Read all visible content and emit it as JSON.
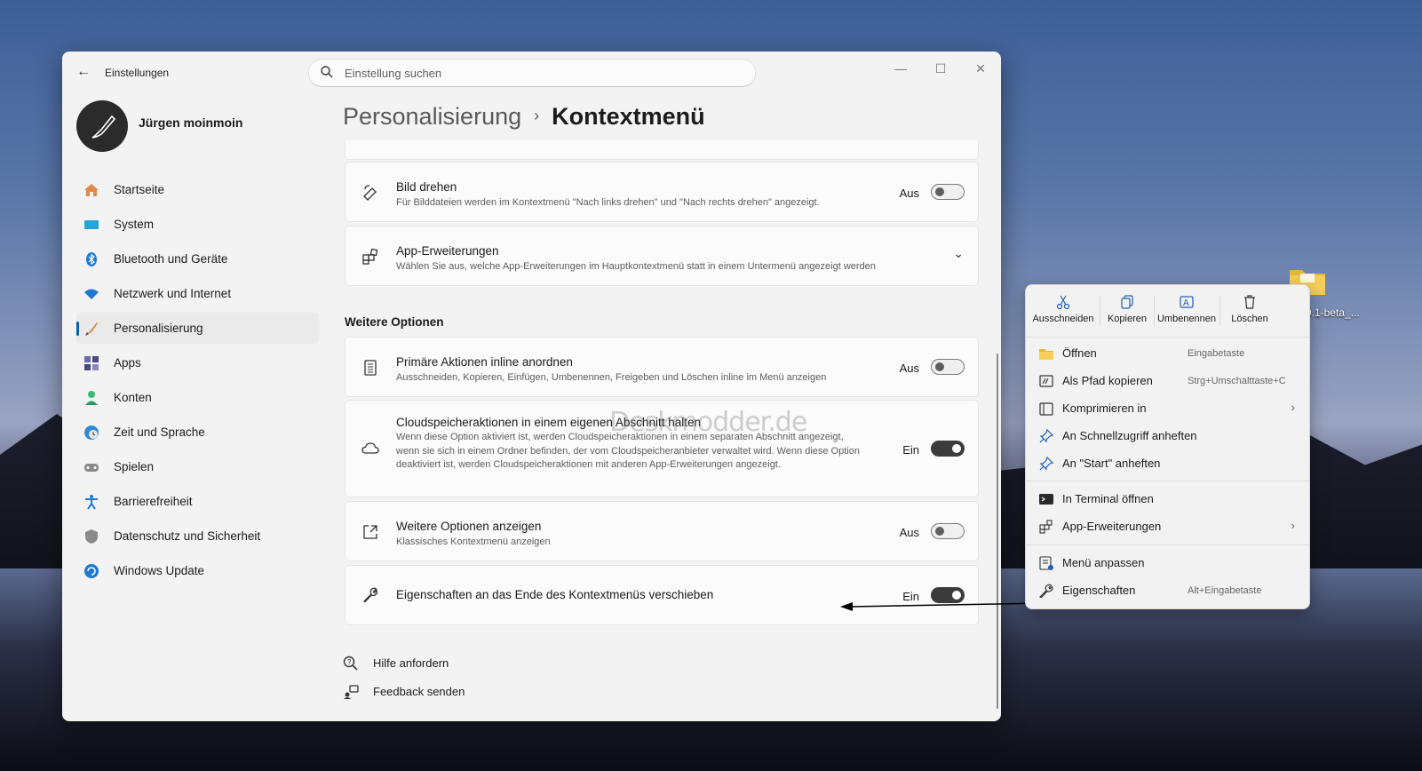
{
  "window": {
    "title": "Einstellungen",
    "search_placeholder": "Einstellung suchen",
    "user_name": "Jürgen moinmoin"
  },
  "nav": [
    {
      "label": "Startseite",
      "icon": "home-icon"
    },
    {
      "label": "System",
      "icon": "system-icon"
    },
    {
      "label": "Bluetooth und Geräte",
      "icon": "bluetooth-icon"
    },
    {
      "label": "Netzwerk und Internet",
      "icon": "wifi-icon"
    },
    {
      "label": "Personalisierung",
      "icon": "brush-icon",
      "active": true
    },
    {
      "label": "Apps",
      "icon": "apps-icon"
    },
    {
      "label": "Konten",
      "icon": "account-icon"
    },
    {
      "label": "Zeit und Sprache",
      "icon": "clock-globe-icon"
    },
    {
      "label": "Spielen",
      "icon": "gamepad-icon"
    },
    {
      "label": "Barrierefreiheit",
      "icon": "accessibility-icon"
    },
    {
      "label": "Datenschutz und Sicherheit",
      "icon": "shield-icon"
    },
    {
      "label": "Windows Update",
      "icon": "update-icon"
    }
  ],
  "breadcrumb": {
    "parent": "Personalisierung",
    "separator": "›",
    "current": "Kontextmenü"
  },
  "cards": {
    "rotate": {
      "title": "Bild drehen",
      "desc": "Für Bilddateien werden im Kontextmenü \"Nach links drehen\" und \"Nach rechts drehen\" angezeigt.",
      "state": "Aus"
    },
    "app_ext": {
      "title": "App-Erweiterungen",
      "desc": "Wählen Sie aus, welche App-Erweiterungen im Hauptkontextmenü statt in einem Untermenü angezeigt werden"
    },
    "section_title": "Weitere Optionen",
    "inline": {
      "title": "Primäre Aktionen inline anordnen",
      "desc": "Ausschneiden, Kopieren, Einfügen, Umbenennen, Freigeben und Löschen inline im Menü anzeigen",
      "state": "Aus"
    },
    "cloud": {
      "title": "Cloudspeicheraktionen in einem eigenen Abschnitt halten",
      "desc": "Wenn diese Option aktiviert ist, werden Cloudspeicheraktionen in einem separaten Abschnitt angezeigt, wenn sie sich in einem Ordner befinden, der vom Cloudspeicheranbieter verwaltet wird. Wenn diese Option deaktiviert ist, werden Cloudspeicheraktionen mit anderen App-Erweiterungen angezeigt.",
      "state": "Ein"
    },
    "more": {
      "title": "Weitere Optionen anzeigen",
      "desc": "Klassisches Kontextmenü anzeigen",
      "state": "Aus"
    },
    "props": {
      "title": "Eigenschaften an das Ende des Kontextmenüs verschieben",
      "state": "Ein"
    }
  },
  "links": {
    "help": "Hilfe anfordern",
    "feedback": "Feedback senden"
  },
  "watermark": "Deskmodder.de",
  "desktop_icon_label": "9.1-beta_...",
  "context_menu": {
    "quick": [
      {
        "label": "Ausschneiden",
        "icon": "scissors-icon"
      },
      {
        "label": "Kopieren",
        "icon": "copy-icon"
      },
      {
        "label": "Umbenennen",
        "icon": "rename-icon"
      },
      {
        "label": "Löschen",
        "icon": "trash-icon"
      }
    ],
    "items": [
      {
        "label": "Öffnen",
        "shortcut": "Eingabetaste",
        "icon": "folder-icon"
      },
      {
        "label": "Als Pfad kopieren",
        "shortcut": "Strg+Umschalttaste+C",
        "icon": "copy-path-icon"
      },
      {
        "label": "Komprimieren in",
        "icon": "archive-icon",
        "submenu": true
      },
      {
        "label": "An Schnellzugriff anheften",
        "icon": "pin-icon"
      },
      {
        "label": "An \"Start\" anheften",
        "icon": "pin-icon"
      },
      {
        "label": "In Terminal öffnen",
        "icon": "terminal-icon"
      },
      {
        "label": "App-Erweiterungen",
        "icon": "app-ext-icon",
        "submenu": true
      },
      {
        "label": "Menü anpassen",
        "icon": "customize-icon"
      },
      {
        "label": "Eigenschaften",
        "shortcut": "Alt+Eingabetaste",
        "icon": "wrench-icon"
      }
    ]
  },
  "colors": {
    "accent": "#005fb8",
    "toggle_on": "#3b3b3b"
  }
}
